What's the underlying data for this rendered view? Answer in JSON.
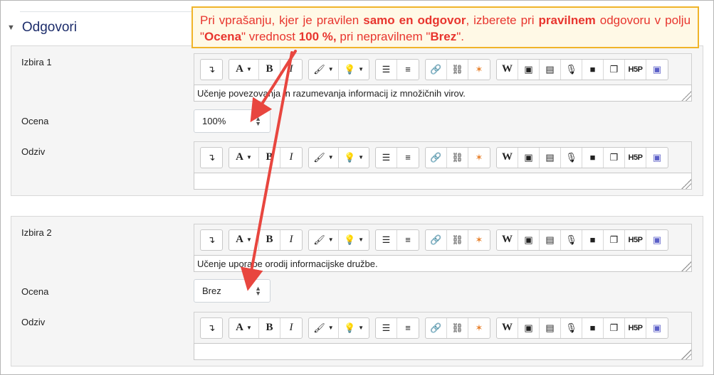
{
  "section": {
    "title": "Odgovori"
  },
  "callout": {
    "t1": "Pri vprašanju, kjer je pravilen ",
    "t2": "samo en odgovor",
    "t3": ", izberete pri ",
    "t4": "pravilnem",
    "t5": " odgovoru v polju \"",
    "t6": "Ocena",
    "t7": "\" vrednost ",
    "t8": "100 %,",
    "t9": " pri nepravilnem \"",
    "t10": "Brez",
    "t11": "\"."
  },
  "choices": [
    {
      "label": "Izbira 1",
      "answer_text": "Učenje povezovanja in razumevanja informacij iz množičnih virov.",
      "grade_label": "Ocena",
      "grade_value": "100%",
      "feedback_label": "Odziv",
      "feedback_text": ""
    },
    {
      "label": "Izbira 2",
      "answer_text": "Učenje uporabe orodij informacijske družbe.",
      "grade_label": "Ocena",
      "grade_value": "Brez",
      "feedback_label": "Odziv",
      "feedback_text": ""
    }
  ],
  "toolbar": {
    "font_label": "A",
    "bold_label": "B",
    "italic_label": "I",
    "h5p_label": "H5P",
    "word_label": "W"
  },
  "colors": {
    "callout_text": "#e8352e",
    "callout_border": "#f0b429",
    "arrow": "#e8463f",
    "heading": "#1d2d6b"
  }
}
